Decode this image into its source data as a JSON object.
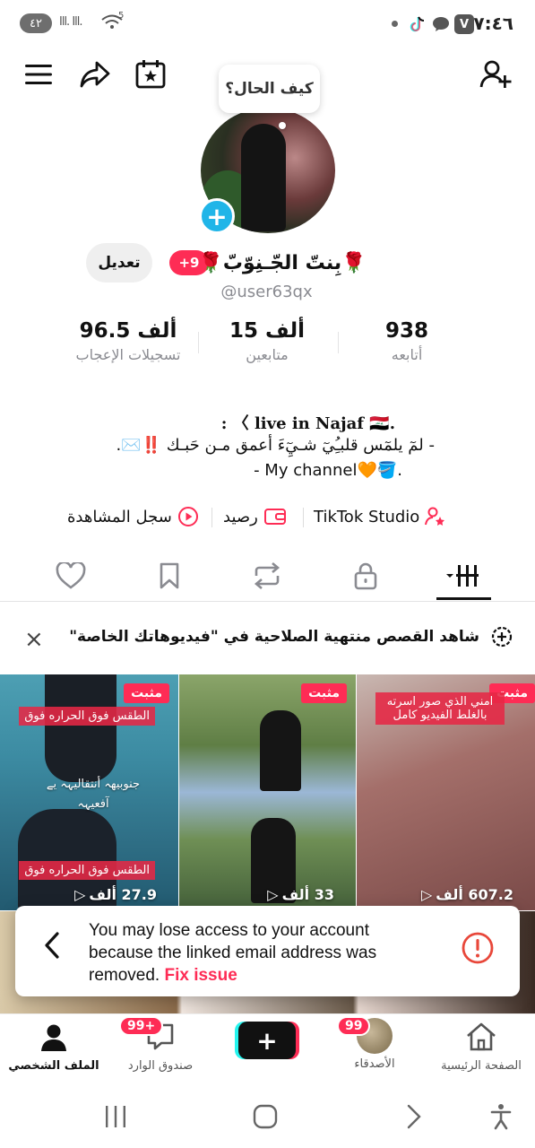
{
  "status_bar": {
    "time": "٧:٤٦",
    "battery": "٤٢",
    "signal": "Ill. Ill.",
    "wifi_badge": "5"
  },
  "header": {
    "menu_icon": "hamburger-icon",
    "share_icon": "share-arrow-icon",
    "calendar_icon": "calendar-star-icon",
    "add_friend_icon": "add-user-icon"
  },
  "profile": {
    "note_bubble": "كيف الحال؟",
    "display_name": "🌹بِنتّ الجّـنِوّبّ🌹",
    "notification_badge": "+9",
    "edit_label": "تعديل",
    "username": "@user63qx",
    "stats": [
      {
        "value": "938",
        "label": "أتابعه"
      },
      {
        "value": "15 ألف",
        "label": "متابعين"
      },
      {
        "value": "96.5 ألف",
        "label": "تسجيلات الإعجاب"
      }
    ],
    "bio_lines": [
      ": 〈 live in Najaf 🇮🇶.",
      "- لمٓ يلمٓس قلبـُِيٓ شـيِٓءَ أعمق مـن حَبـك ‼️✉️.",
      "- My channel🧡🪣."
    ],
    "links": {
      "studio": "TikTok Studio",
      "balance": "رصيد",
      "watch_history": "سجل المشاهدة"
    }
  },
  "promo": {
    "text": "شاهد القصص منتهية الصلاحية في \"فيديوهاتك الخاصة\"",
    "close": "×"
  },
  "videos": [
    {
      "pinned": "مثبت",
      "caption_top": "امني الذي صور اسرته بالغلط الفيديو كامل",
      "views": "607.2 ألف"
    },
    {
      "pinned": "مثبت",
      "views": "33 ألف"
    },
    {
      "pinned": "مثبت",
      "caption_top": "الطقس فوق الحراره فوق",
      "caption_mid": "جنوبيهہ أنتقاليہہ يے آفعيہہ",
      "caption_bottom": "الطقس فوق الحراره فوق",
      "views": "27.9 ألف"
    }
  ],
  "toast": {
    "message": "You may lose access to your account because the linked email address was removed.",
    "action": "Fix issue"
  },
  "bottom_nav": {
    "home": "الصفحة الرئيسية",
    "friends": "الأصدقاء",
    "friends_badge": "99",
    "create": "+",
    "inbox": "صندوق الوارد",
    "inbox_badge": "99+",
    "profile": "الملف الشخصي"
  },
  "colors": {
    "accent": "#fe2c55",
    "cyan": "#25f4ee",
    "badge_blue": "#20b5e8",
    "text_secondary": "#8a8b91"
  }
}
